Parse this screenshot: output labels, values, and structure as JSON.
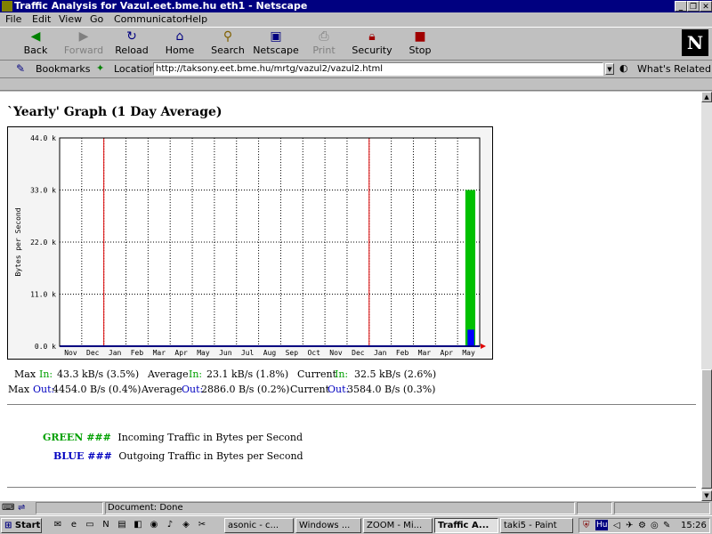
{
  "window": {
    "title": "Traffic Analysis for Vazul.eet.bme.hu eth1 - Netscape",
    "controls": {
      "minimize": "_",
      "restore": "❐",
      "close": "✕"
    }
  },
  "menu": [
    "File",
    "Edit",
    "View",
    "Go",
    "Communicator",
    "Help"
  ],
  "toolbar": [
    {
      "label": "Back",
      "icon": "back-arrow-icon",
      "enabled": true
    },
    {
      "label": "Forward",
      "icon": "forward-arrow-icon",
      "enabled": false
    },
    {
      "label": "Reload",
      "icon": "reload-icon",
      "enabled": true
    },
    {
      "label": "Home",
      "icon": "home-icon",
      "enabled": true
    },
    {
      "label": "Search",
      "icon": "search-icon",
      "enabled": true
    },
    {
      "label": "Netscape",
      "icon": "netscape-icon",
      "enabled": true
    },
    {
      "label": "Print",
      "icon": "print-icon",
      "enabled": false
    },
    {
      "label": "Security",
      "icon": "lock-icon",
      "enabled": true
    },
    {
      "label": "Stop",
      "icon": "stop-icon",
      "enabled": true
    }
  ],
  "netscape_logo": "N",
  "location": {
    "bookmarks_label": "Bookmarks",
    "location_label": "Location:",
    "url": "http://taksony.eet.bme.hu/mrtg/vazul2/vazul2.html",
    "whats_related": "What's Related"
  },
  "page": {
    "graph_title": "`Yearly' Graph (1 Day Average)",
    "stats": {
      "in": {
        "max_label": "Max",
        "max_key": "In:",
        "max_value": "43.3 kB/s (3.5%)",
        "avg_label": "Average",
        "avg_key": "In:",
        "avg_value": "23.1 kB/s (1.8%)",
        "cur_label": "Current",
        "cur_key": "In:",
        "cur_value": "32.5 kB/s (2.6%)"
      },
      "out": {
        "max_label": "Max",
        "max_key": "Out:",
        "max_value": "4454.0 B/s (0.4%)",
        "avg_label": "Average",
        "avg_key": "Out:",
        "avg_value": "2886.0 B/s (0.2%)",
        "cur_label": "Current",
        "cur_key": "Out:",
        "cur_value": "3584.0 B/s (0.3%)"
      }
    },
    "legend": [
      {
        "key": "GREEN ###",
        "text": "Incoming Traffic in Bytes per Second",
        "color": "#00a000"
      },
      {
        "key": "BLUE ###",
        "text": "Outgoing Traffic in Bytes per Second",
        "color": "#0000c0"
      }
    ]
  },
  "chart_data": {
    "type": "area",
    "title": "",
    "xlabel": "",
    "ylabel": "Bytes per Second",
    "ylim": [
      0,
      44000
    ],
    "yticks": [
      "0.0 k",
      "11.0 k",
      "22.0 k",
      "33.0 k",
      "44.0 k"
    ],
    "categories": [
      "Nov",
      "Dec",
      "Jan",
      "Feb",
      "Mar",
      "Apr",
      "May",
      "Jun",
      "Jul",
      "Aug",
      "Sep",
      "Oct",
      "Nov",
      "Dec",
      "Jan",
      "Feb",
      "Mar",
      "Apr",
      "May"
    ],
    "grid": true,
    "year_markers": [
      "Jan",
      "Jan"
    ],
    "series": [
      {
        "name": "Incoming",
        "color": "#00c000",
        "values": [
          0,
          0,
          0,
          0,
          0,
          0,
          0,
          0,
          0,
          0,
          0,
          0,
          0,
          0,
          0,
          0,
          0,
          0,
          33000
        ]
      },
      {
        "name": "Outgoing",
        "color": "#0000ff",
        "values": [
          0,
          0,
          0,
          0,
          0,
          0,
          0,
          0,
          0,
          0,
          0,
          0,
          0,
          0,
          0,
          0,
          0,
          0,
          3500
        ]
      }
    ]
  },
  "status": {
    "text": "Document: Done"
  },
  "taskbar": {
    "start": "Start",
    "buttons": [
      {
        "label": "asonic - c...",
        "active": false
      },
      {
        "label": "Windows ...",
        "active": false
      },
      {
        "label": "ZOOM - Mi...",
        "active": false
      },
      {
        "label": "Traffic A...",
        "active": true
      },
      {
        "label": "taki5 - Paint",
        "active": false
      }
    ],
    "tray_lang": "Hu",
    "clock": "15:26"
  }
}
